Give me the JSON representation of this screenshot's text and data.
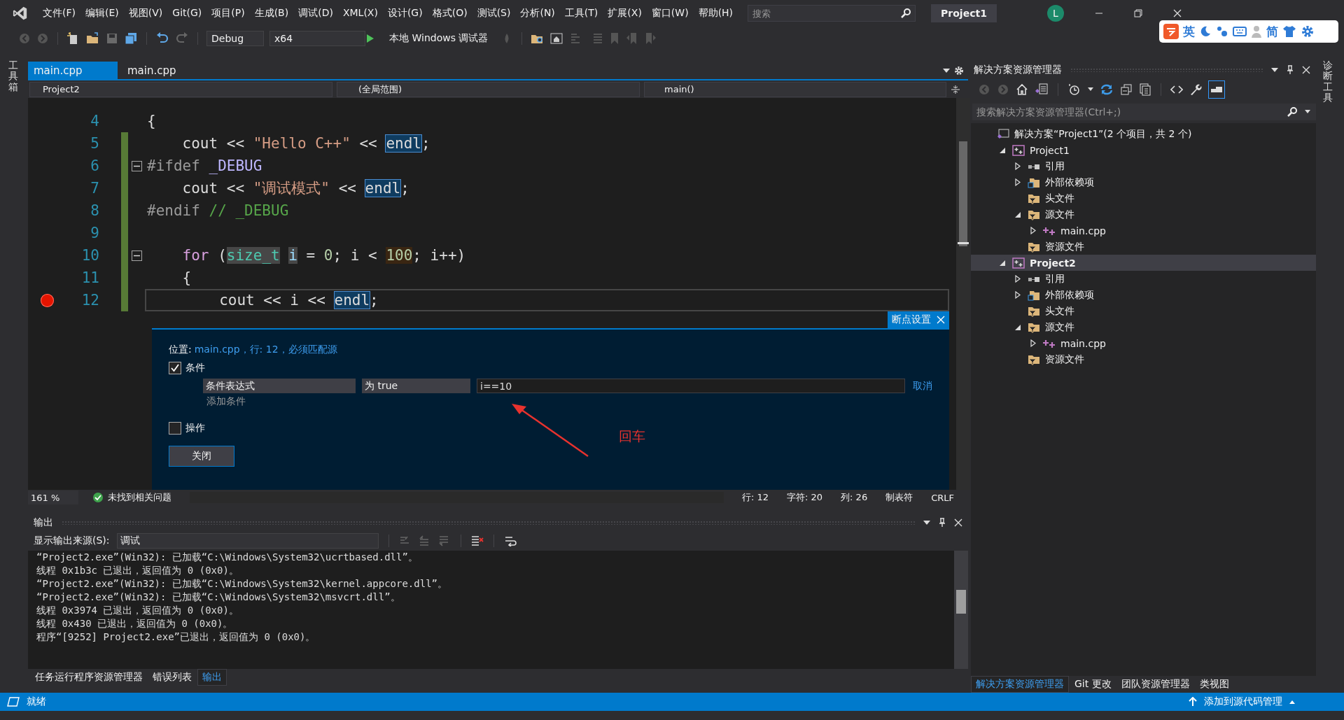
{
  "menu": {
    "items": [
      "文件(F)",
      "编辑(E)",
      "视图(V)",
      "Git(G)",
      "项目(P)",
      "生成(B)",
      "调试(D)",
      "XML(X)",
      "设计(G)",
      "格式(O)",
      "测试(S)",
      "分析(N)",
      "工具(T)",
      "扩展(X)",
      "窗口(W)",
      "帮助(H)"
    ]
  },
  "title_bar": {
    "search_placeholder": "搜索",
    "solution": "Project1",
    "avatar": "L"
  },
  "toolbar": {
    "configuration": "Debug",
    "platform": "x64",
    "run": "本地 Windows 调试器"
  },
  "ime_bar": {
    "language": "英",
    "script": "简"
  },
  "left_strip": {
    "label": "工具箱"
  },
  "right_strip": {
    "label": "诊断工具"
  },
  "editor": {
    "tabs": [
      {
        "label": "main.cpp",
        "selected": true
      },
      {
        "label": "main.cpp",
        "selected": false
      }
    ],
    "nav": {
      "project": "Project2",
      "scope": "(全局范围)",
      "member": "main()"
    },
    "lines": [
      {
        "number": "4",
        "breakpoint": false,
        "fold": false,
        "changed": false,
        "current": false,
        "tokens": [
          {
            "text": "{",
            "kind": "plain"
          }
        ]
      },
      {
        "number": "5",
        "breakpoint": false,
        "fold": false,
        "changed": true,
        "current": false,
        "tokens": [
          {
            "text": "    cout << ",
            "kind": "plain"
          },
          {
            "text": "\"Hello C++\"",
            "kind": "string"
          },
          {
            "text": " << ",
            "kind": "plain"
          },
          {
            "text": "endl",
            "kind": "reference"
          },
          {
            "text": ";",
            "kind": "plain"
          }
        ]
      },
      {
        "number": "6",
        "breakpoint": false,
        "fold": true,
        "changed": true,
        "current": false,
        "tokens": [
          {
            "text": "#ifdef ",
            "kind": "directive"
          },
          {
            "text": "_DEBUG",
            "kind": "macro"
          }
        ]
      },
      {
        "number": "7",
        "breakpoint": false,
        "fold": false,
        "changed": true,
        "current": false,
        "tokens": [
          {
            "text": "    cout << ",
            "kind": "plain"
          },
          {
            "text": "\"调试模式\"",
            "kind": "string"
          },
          {
            "text": " << ",
            "kind": "plain"
          },
          {
            "text": "endl",
            "kind": "reference"
          },
          {
            "text": ";",
            "kind": "plain"
          }
        ]
      },
      {
        "number": "8",
        "breakpoint": false,
        "fold": false,
        "changed": true,
        "current": false,
        "tokens": [
          {
            "text": "#endif",
            "kind": "directive"
          },
          {
            "text": " // _DEBUG",
            "kind": "comment"
          }
        ]
      },
      {
        "number": "9",
        "breakpoint": false,
        "fold": false,
        "changed": true,
        "current": false
      },
      {
        "number": "10",
        "breakpoint": false,
        "fold": true,
        "changed": true,
        "current": false,
        "tokens": [
          {
            "text": "    for",
            "kind": "keyword"
          },
          {
            "text": " (",
            "kind": "plain"
          },
          {
            "text": "size_t",
            "kind": "shaded-type"
          },
          {
            "text": "i",
            "kind": "shaded-name"
          },
          {
            "text": " = ",
            "kind": "plain"
          },
          {
            "text": "0",
            "kind": "number"
          },
          {
            "text": "; i < ",
            "kind": "plain"
          },
          {
            "text": "100",
            "kind": "highlighted-number"
          },
          {
            "text": "; i++)",
            "kind": "plain"
          }
        ]
      },
      {
        "number": "11",
        "breakpoint": false,
        "fold": false,
        "changed": true,
        "current": false,
        "tokens": [
          {
            "text": "    {",
            "kind": "plain"
          }
        ]
      },
      {
        "number": "12",
        "breakpoint": true,
        "fold": false,
        "changed": true,
        "current": true,
        "tokens": [
          {
            "text": "        cout << i << ",
            "kind": "plain"
          },
          {
            "text": "endl",
            "kind": "reference"
          },
          {
            "text": ";",
            "kind": "plain"
          }
        ]
      }
    ],
    "status": {
      "zoom": "161 %",
      "issues": "未找到相关问题",
      "line": "行: 12",
      "char": "字符: 20",
      "column": "列: 26",
      "indent": "制表符",
      "eol": "CRLF"
    }
  },
  "breakpoint_settings": {
    "title": "断点设置",
    "location_label": "位置:",
    "location": "main.cpp，行: 12，必须匹配源",
    "condition": {
      "label": "条件",
      "checked": true,
      "type": "条件表达式",
      "mode": "为 true",
      "value": "i==10",
      "cancel": "取消",
      "add": "添加条件"
    },
    "action": {
      "label": "操作",
      "checked": false
    },
    "close": "关闭",
    "annotation": "回车"
  },
  "output": {
    "title": "输出",
    "source_label": "显示输出来源(S):",
    "source": "调试",
    "lines": [
      "“Project2.exe”(Win32): 已加载“C:\\Windows\\System32\\ucrtbased.dll”。",
      "线程 0x1b3c 已退出，返回值为 0 (0x0)。",
      "“Project2.exe”(Win32): 已加载“C:\\Windows\\System32\\kernel.appcore.dll”。",
      "“Project2.exe”(Win32): 已加载“C:\\Windows\\System32\\msvcrt.dll”。",
      "线程 0x3974 已退出，返回值为 0 (0x0)。",
      "线程 0x430 已退出，返回值为 0 (0x0)。",
      "程序“[9252] Project2.exe”已退出，返回值为 0 (0x0)。"
    ],
    "tabs": [
      {
        "label": "任务运行程序资源管理器",
        "selected": false
      },
      {
        "label": "错误列表",
        "selected": false
      },
      {
        "label": "输出",
        "selected": true
      }
    ]
  },
  "solution_explorer": {
    "title": "解决方案资源管理器",
    "search_placeholder": "搜索解决方案资源管理器(Ctrl+;)",
    "tree": [
      {
        "label": "解决方案“Project1”(2 个项目，共 2 个)",
        "kind": "solution",
        "selected": false,
        "children": [
          {
            "label": "Project1",
            "kind": "project",
            "expanded": true,
            "selected": false,
            "children": [
              {
                "label": "引用",
                "kind": "references",
                "expanded": false,
                "selected": false
              },
              {
                "label": "外部依赖项",
                "kind": "external",
                "expanded": false,
                "selected": false
              },
              {
                "label": "头文件",
                "kind": "filter",
                "selected": false
              },
              {
                "label": "源文件",
                "kind": "filter",
                "expanded": true,
                "selected": false,
                "children": [
                  {
                    "label": "main.cpp",
                    "kind": "cpp",
                    "expanded": false,
                    "selected": false
                  }
                ]
              },
              {
                "label": "资源文件",
                "kind": "filter",
                "selected": false
              }
            ]
          },
          {
            "label": "Project2",
            "kind": "project",
            "expanded": true,
            "selected": true,
            "children": [
              {
                "label": "引用",
                "kind": "references",
                "expanded": false,
                "selected": false
              },
              {
                "label": "外部依赖项",
                "kind": "external",
                "expanded": false,
                "selected": false
              },
              {
                "label": "头文件",
                "kind": "filter",
                "selected": false
              },
              {
                "label": "源文件",
                "kind": "filter",
                "expanded": true,
                "selected": false,
                "children": [
                  {
                    "label": "main.cpp",
                    "kind": "cpp",
                    "expanded": false,
                    "selected": false
                  }
                ]
              },
              {
                "label": "资源文件",
                "kind": "filter",
                "selected": false
              }
            ]
          }
        ]
      }
    ],
    "tabs": [
      {
        "label": "解决方案资源管理器",
        "selected": true
      },
      {
        "label": "Git 更改",
        "selected": false
      },
      {
        "label": "团队资源管理器",
        "selected": false
      },
      {
        "label": "类视图",
        "selected": false
      }
    ]
  },
  "status_bar": {
    "state": "就绪",
    "source_control": "添加到源代码管理"
  }
}
